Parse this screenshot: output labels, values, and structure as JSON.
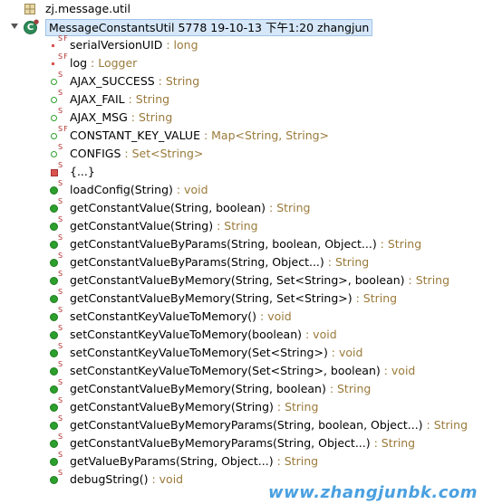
{
  "package": {
    "label": "zj.message.util",
    "icon": "package-icon"
  },
  "class": {
    "label": "MessageConstantsUtil 5778  19-10-13 下午1:20  zhangjun",
    "icon": "class-icon"
  },
  "members": [
    {
      "kind": "field-private-static-final",
      "overlay": "SF",
      "name": "serialVersionUID",
      "type": " : long"
    },
    {
      "kind": "field-private-static-final",
      "overlay": "SF",
      "name": "log",
      "type": " : Logger"
    },
    {
      "kind": "field-default-static",
      "overlay": "S",
      "name": "AJAX_SUCCESS",
      "type": " : String"
    },
    {
      "kind": "field-default-static",
      "overlay": "S",
      "name": "AJAX_FAIL",
      "type": " : String"
    },
    {
      "kind": "field-default-static",
      "overlay": "S",
      "name": "AJAX_MSG",
      "type": " : String"
    },
    {
      "kind": "field-default-static-final",
      "overlay": "SF",
      "name": "CONSTANT_KEY_VALUE",
      "type": " : Map<String, String>"
    },
    {
      "kind": "field-default-static",
      "overlay": "S",
      "name": "CONFIGS",
      "type": " : Set<String>"
    },
    {
      "kind": "initializer",
      "overlay": "S",
      "name": "{...}",
      "type": ""
    },
    {
      "kind": "method-public-static",
      "overlay": "S",
      "name": "loadConfig(String)",
      "type": " : void"
    },
    {
      "kind": "method-public-static",
      "overlay": "S",
      "name": "getConstantValue(String, boolean)",
      "type": " : String"
    },
    {
      "kind": "method-public-static",
      "overlay": "S",
      "name": "getConstantValue(String)",
      "type": " : String"
    },
    {
      "kind": "method-public-static",
      "overlay": "S",
      "name": "getConstantValueByParams(String, boolean, Object...)",
      "type": " : String"
    },
    {
      "kind": "method-public-static",
      "overlay": "S",
      "name": "getConstantValueByParams(String, Object...)",
      "type": " : String"
    },
    {
      "kind": "method-public-static",
      "overlay": "S",
      "name": "getConstantValueByMemory(String, Set<String>, boolean)",
      "type": " : String"
    },
    {
      "kind": "method-public-static",
      "overlay": "S",
      "name": "getConstantValueByMemory(String, Set<String>)",
      "type": " : String"
    },
    {
      "kind": "method-public-static",
      "overlay": "S",
      "name": "setConstantKeyValueToMemory()",
      "type": " : void"
    },
    {
      "kind": "method-public-static",
      "overlay": "S",
      "name": "setConstantKeyValueToMemory(boolean)",
      "type": " : void"
    },
    {
      "kind": "method-public-static",
      "overlay": "S",
      "name": "setConstantKeyValueToMemory(Set<String>)",
      "type": " : void"
    },
    {
      "kind": "method-public-static",
      "overlay": "S",
      "name": "setConstantKeyValueToMemory(Set<String>, boolean)",
      "type": " : void"
    },
    {
      "kind": "method-public-static",
      "overlay": "S",
      "name": "getConstantValueByMemory(String, boolean)",
      "type": " : String"
    },
    {
      "kind": "method-public-static",
      "overlay": "S",
      "name": "getConstantValueByMemory(String)",
      "type": " : String"
    },
    {
      "kind": "method-public-static",
      "overlay": "S",
      "name": "getConstantValueByMemoryParams(String, boolean, Object...)",
      "type": " : String"
    },
    {
      "kind": "method-public-static",
      "overlay": "S",
      "name": "getConstantValueByMemoryParams(String, Object...)",
      "type": " : String"
    },
    {
      "kind": "method-public-static",
      "overlay": "S",
      "name": "getValueByParams(String, Object...)",
      "type": " : String"
    },
    {
      "kind": "method-public-static",
      "overlay": "S",
      "name": "debugString()",
      "type": " : void"
    }
  ],
  "watermark": "www.zhangjunbk.com",
  "colors": {
    "selection": "#d5e7f8",
    "type_text": "#9a7a3a",
    "public": "#2ca02c",
    "private": "#d9534f",
    "watermark": "#4aa0e0"
  }
}
